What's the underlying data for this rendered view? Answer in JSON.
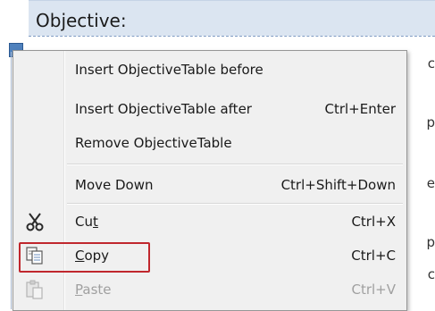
{
  "document": {
    "header_label": "Objective:",
    "right_fragments": [
      "c",
      "p",
      "e",
      "p",
      "c"
    ]
  },
  "menu": {
    "items": [
      {
        "name": "insert-objectivetable-before",
        "label": "Insert ObjectiveTable before",
        "shortcut": "",
        "enabled": true
      },
      {
        "name": "insert-objectivetable-after",
        "label": "Insert ObjectiveTable after",
        "shortcut": "Ctrl+Enter",
        "enabled": true
      },
      {
        "name": "remove-objectivetable",
        "label": "Remove ObjectiveTable",
        "shortcut": "",
        "enabled": true
      },
      {
        "name": "move-down",
        "label": "Move Down",
        "shortcut": "Ctrl+Shift+Down",
        "enabled": true
      },
      {
        "name": "cut",
        "label_pre": "Cu",
        "label_u": "t",
        "label_post": "",
        "shortcut": "Ctrl+X",
        "enabled": true,
        "icon": "scissors-icon"
      },
      {
        "name": "copy",
        "label_pre": "",
        "label_u": "C",
        "label_post": "opy",
        "shortcut": "Ctrl+C",
        "enabled": true,
        "icon": "copy-icon"
      },
      {
        "name": "paste",
        "label_pre": "",
        "label_u": "P",
        "label_post": "aste",
        "shortcut": "Ctrl+V",
        "enabled": false,
        "icon": "paste-icon"
      }
    ]
  },
  "colors": {
    "highlight": "#c0272d",
    "menu_bg": "#f0f0f0",
    "header_bg": "#dbe5f1"
  }
}
